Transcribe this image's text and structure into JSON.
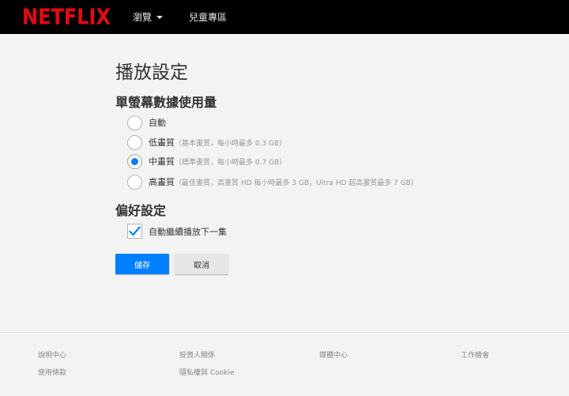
{
  "header": {
    "logo_text": "NETFLIX",
    "nav_browse": "瀏覽",
    "nav_kids": "兒童專區"
  },
  "page": {
    "title": "播放設定",
    "data_usage_heading": "單螢幕數據使用量",
    "preferences_heading": "偏好設定"
  },
  "data_usage_options": [
    {
      "label": "自動",
      "description": "",
      "selected": false
    },
    {
      "label": "低畫質",
      "description": "（基本畫質，每小時最多 0.3 GB）",
      "selected": false
    },
    {
      "label": "中畫質",
      "description": "（標準畫質，每小時最多 0.7 GB）",
      "selected": true
    },
    {
      "label": "高畫質",
      "description": "（最佳畫質，高畫質 HD 每小時最多 3 GB，Ultra HD 超高畫質最多 7 GB）",
      "selected": false
    }
  ],
  "preferences": {
    "autoplay_label": "自動繼續播放下一集",
    "autoplay_checked": true
  },
  "buttons": {
    "save": "儲存",
    "cancel": "取消"
  },
  "footer": {
    "help_center": "說明中心",
    "investor_relations": "投資人關係",
    "media_center": "媒體中心",
    "jobs": "工作機會",
    "terms_of_use": "使用條款",
    "privacy_cookies": "隱私權與 Cookie"
  },
  "colors": {
    "brand_red": "#e50914",
    "accent_blue": "#0080ff",
    "header_bg": "#000000",
    "page_bg": "#f3f3f3"
  }
}
